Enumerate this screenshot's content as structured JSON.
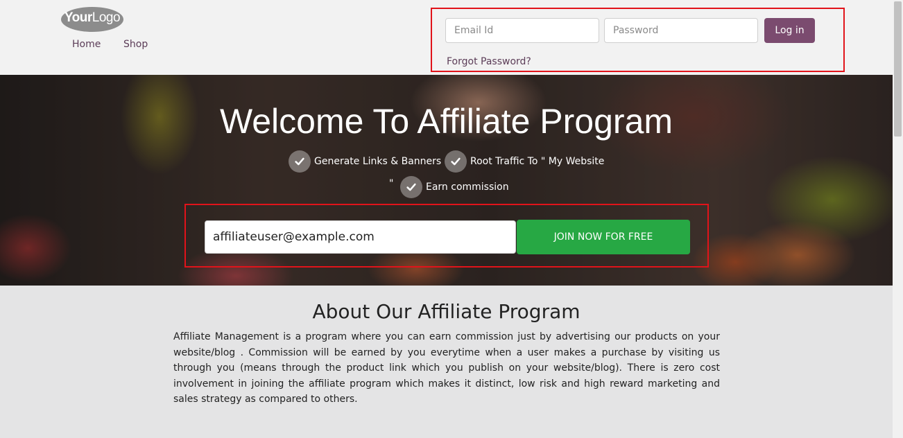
{
  "header": {
    "logo": {
      "text_bold": "Your",
      "text_light": "Logo"
    },
    "nav": [
      {
        "label": "Home"
      },
      {
        "label": "Shop"
      }
    ]
  },
  "login": {
    "email_placeholder": "Email Id",
    "password_placeholder": "Password",
    "login_label": "Log in",
    "forgot_label": "Forgot Password?"
  },
  "hero": {
    "title": "Welcome To Affiliate Program",
    "features": [
      {
        "label": "Generate Links & Banners",
        "icon": "check-icon"
      },
      {
        "label": "Root Traffic To \" My Website",
        "icon": "check-icon"
      },
      {
        "label": "Earn commission",
        "icon": "check-icon"
      }
    ],
    "stray_quote": "\"",
    "join_input_value": "affiliateuser@example.com",
    "join_label": "JOIN NOW FOR FREE"
  },
  "about": {
    "title": "About Our Affiliate Program",
    "body": "Affiliate Management is a program where you can earn commission just by advertising our products on your website/blog . Commission will be earned by you everytime when a user makes a purchase by visiting us through you (means through the product link which you publish on your website/blog). There is zero cost involvement in joining the affiliate program which makes it distinct, low risk and high reward marketing and sales strategy as compared to others."
  },
  "colors": {
    "brand_purple": "#7b4b6f",
    "link_purple": "#5b3c57",
    "join_green": "#27a844",
    "highlight_red": "#e1131a"
  }
}
